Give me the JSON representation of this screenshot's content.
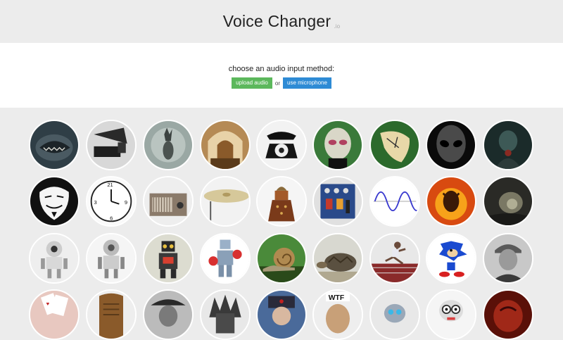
{
  "header": {
    "title": "Voice Changer",
    "tld": ".io"
  },
  "input": {
    "prompt": "choose an audio input method:",
    "upload_label": "upload audio",
    "or_label": "or",
    "mic_label": "use microphone"
  },
  "voices": [
    [
      "fish-icon",
      "phonograph-icon",
      "ghost-icon",
      "church-icon",
      "telephone-icon",
      "alien-icon",
      "melting-clock-icon",
      "grey-alien-icon",
      "dark-figure-icon"
    ],
    [
      "anonymous-mask-icon",
      "backwards-clock-icon",
      "radio-icon",
      "cymbal-icon",
      "dalek-icon",
      "synthesizer-icon",
      "sine-wave-icon",
      "balrog-icon",
      "cave-icon"
    ],
    [
      "robot-white-icon",
      "robot-silver-icon",
      "toy-robot-icon",
      "robot-boxer-icon",
      "snail-icon",
      "tortoise-icon",
      "sprinter-icon",
      "sonic-icon",
      "old-man-icon"
    ],
    [
      "cards-icon",
      "wooden-speaker-icon",
      "man-in-hat-icon",
      "knight-icon",
      "soldier-icon",
      "wtf-face-icon",
      "robot-head-icon",
      "cartoon-robot-icon",
      "red-creature-icon"
    ]
  ],
  "colors": {
    "upload": "#5cb85c",
    "mic": "#2e8bd5"
  }
}
